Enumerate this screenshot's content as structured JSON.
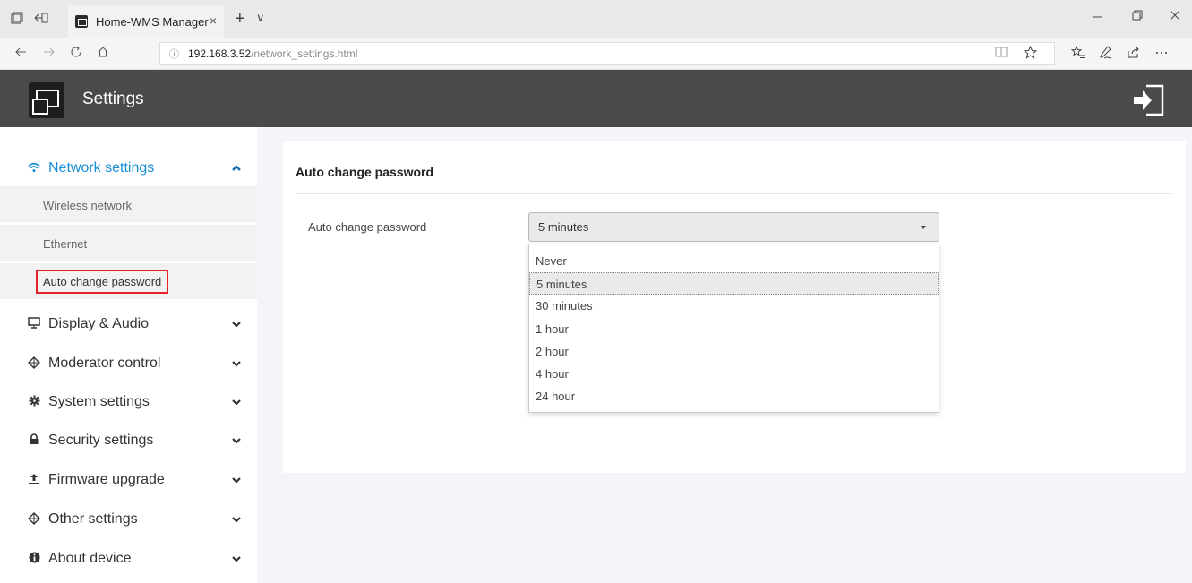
{
  "browser": {
    "tab_title": "Home-WMS Manager",
    "tab_close": "×",
    "new_tab": "+",
    "tab_menu": "∨",
    "url_host": "192.168.3.52",
    "url_path": "/network_settings.html",
    "info_icon": "ⓘ"
  },
  "app": {
    "title": "Settings"
  },
  "sidebar": {
    "items": [
      {
        "label": "Network settings",
        "icon": "wifi-icon",
        "expanded": true
      },
      {
        "label": "Display & Audio",
        "icon": "monitor-icon"
      },
      {
        "label": "Moderator control",
        "icon": "moderator-icon"
      },
      {
        "label": "System settings",
        "icon": "gear-icon"
      },
      {
        "label": "Security settings",
        "icon": "lock-icon"
      },
      {
        "label": "Firmware upgrade",
        "icon": "upload-icon"
      },
      {
        "label": "Other settings",
        "icon": "settings-alt-icon"
      },
      {
        "label": "About device",
        "icon": "info-icon"
      }
    ],
    "sub_items": [
      {
        "label": "Wireless network"
      },
      {
        "label": "Ethernet"
      },
      {
        "label": "Auto change password",
        "selected": true
      }
    ]
  },
  "main": {
    "title": "Auto change password",
    "field_label": "Auto change password",
    "selected_value": "5 minutes",
    "options": [
      "Never",
      "5 minutes",
      "30 minutes",
      "1 hour",
      "2 hour",
      "4 hour",
      "24 hour"
    ]
  },
  "colors": {
    "accent": "#1a8fd8",
    "header_bg": "#4a4a4a",
    "highlight_border": "#e22424"
  }
}
